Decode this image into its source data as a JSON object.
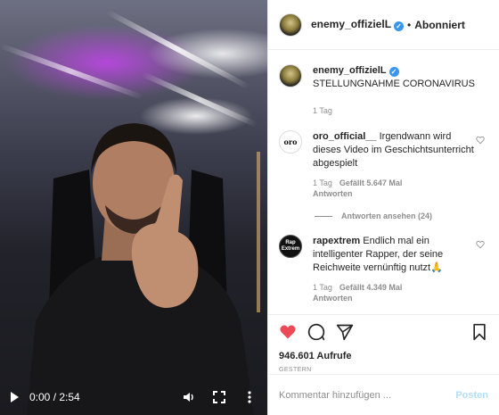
{
  "video": {
    "time": "0:00 / 2:54",
    "icons": [
      "play-icon",
      "volume-icon",
      "fullscreen-icon",
      "more-icon"
    ]
  },
  "header": {
    "username": "enemy_offizielL",
    "dot": "•",
    "follow_status": "Abonniert"
  },
  "caption": {
    "username": "enemy_offizielL",
    "text": "STELLUNGNAHME CORONAVIRUS",
    "age": "1 Tag"
  },
  "comments": [
    {
      "avatar_text": "oro",
      "username": "oro_official__",
      "text": "Irgendwann wird dieses Video im Geschichtsunterricht abgespielt",
      "age": "1 Tag",
      "likes": "Gefällt 5.647 Mal",
      "reply": "Antworten"
    },
    {
      "avatar_text": "Rap Extrem",
      "username": "rapextrem",
      "text": "Endlich mal ein intelligenter Rapper, der seine Reichweite vernünftig nutzt🙏",
      "age": "1 Tag",
      "likes": "Gefällt 4.349 Mal",
      "reply": "Antworten"
    }
  ],
  "view_replies": "Antworten ansehen (24)",
  "stats": {
    "views": "946.601 Aufrufe",
    "date": "GESTERN"
  },
  "add_comment": {
    "placeholder": "Kommentar hinzufügen ...",
    "post_label": "Posten"
  },
  "colors": {
    "like_red": "#ed4956",
    "verified_blue": "#3897f0",
    "muted": "#8e8e8e",
    "post_button": "#b2dffc"
  }
}
